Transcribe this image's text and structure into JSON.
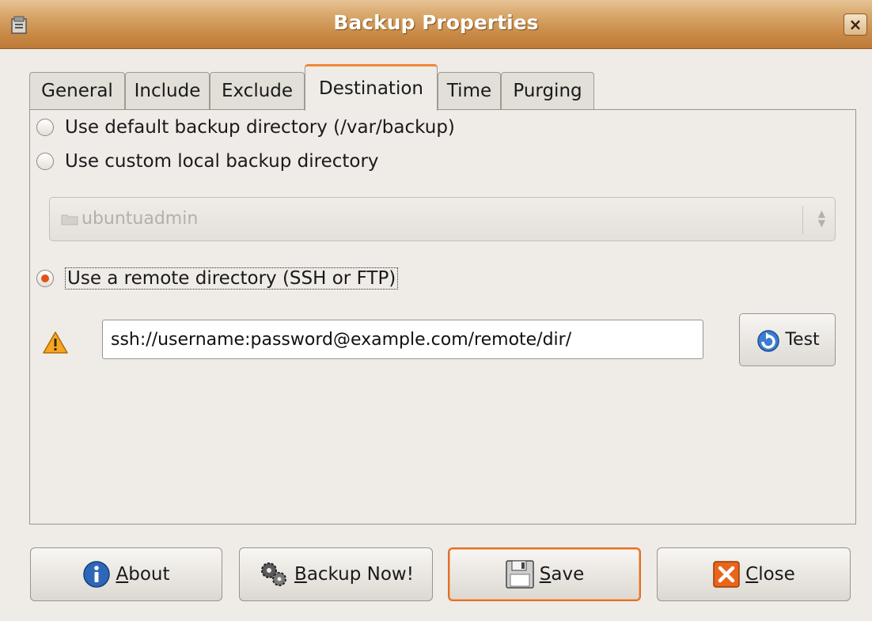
{
  "window": {
    "title": "Backup Properties",
    "close_glyph": "×"
  },
  "tabs": [
    {
      "label": "General"
    },
    {
      "label": "Include"
    },
    {
      "label": "Exclude"
    },
    {
      "label": "Destination"
    },
    {
      "label": "Time"
    },
    {
      "label": "Purging"
    }
  ],
  "active_tab": "Destination",
  "destination": {
    "option_default": "Use default backup directory (/var/backup)",
    "option_custom": "Use custom local backup directory",
    "folder_combo_value": "ubuntuadmin",
    "option_remote": "Use a remote directory (SSH or FTP)",
    "selected_option": "remote",
    "remote_url": "ssh://username:password@example.com/remote/dir/",
    "test_label": "Test"
  },
  "buttons": {
    "about": {
      "mnemonic": "A",
      "rest": "bout"
    },
    "backup_now": {
      "mnemonic": "B",
      "rest": "ackup Now!"
    },
    "save": {
      "mnemonic": "S",
      "rest": "ave"
    },
    "close": {
      "mnemonic": "C",
      "rest": "lose"
    }
  },
  "icons": {
    "app": "backup-app-icon",
    "warning": "warning-icon",
    "test": "refresh-icon",
    "about": "info-icon",
    "backup_now": "gears-icon",
    "save": "floppy-disk-icon",
    "close": "close-icon",
    "folder": "folder-icon"
  },
  "colors": {
    "accent": "#f0883a",
    "titlebar": "#c98a47",
    "radio_checked": "#e0531a"
  }
}
